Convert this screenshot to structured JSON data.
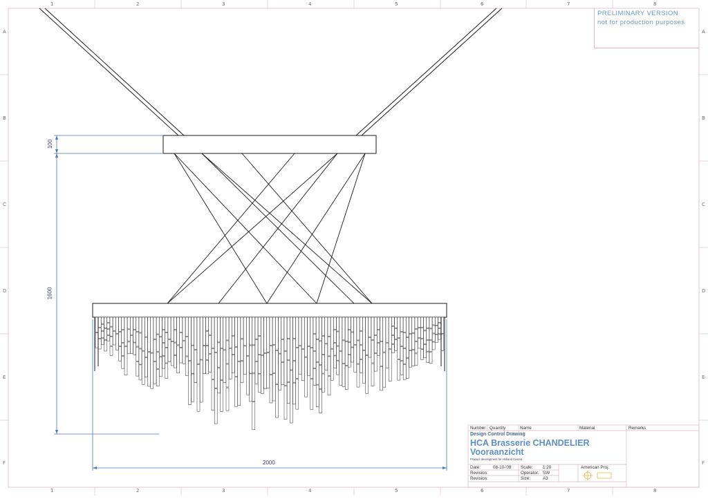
{
  "border": {
    "col_numbers": [
      "1",
      "2",
      "3",
      "4",
      "5",
      "6",
      "7",
      "8"
    ],
    "row_letters": [
      "A",
      "B",
      "C",
      "D",
      "E",
      "F"
    ]
  },
  "preliminary": {
    "line1": "PRELIMINARY  VERSION",
    "line2": "not  for  production  purposes"
  },
  "dimensions": {
    "top_plate": "100",
    "height": "1600",
    "width": "2000"
  },
  "title_block": {
    "headers": {
      "number": "Number",
      "quantity": "Quantity",
      "name": "Name",
      "material": "Material",
      "remarks": "Remarks"
    },
    "drawing_type": "Design Control Drawing",
    "title": "HCA Brasserie CHANDELIER",
    "subtitle": "Vooraanzicht",
    "tagline": "Product development for Holland Casino",
    "date_label": "Date:",
    "date_value": "08-10-'09",
    "scale_label": "Scale:",
    "scale_value": "1:20",
    "revision_label_1": "Revision:",
    "revision_label_2": "Revision:",
    "operator_label": "Operator:",
    "operator_value": "SW",
    "size_label": "Size:",
    "size_value": "A3",
    "projection": "American  Proj."
  },
  "colors": {
    "line": "#1a1a1a",
    "dimension": "#4a78c0",
    "frame": "#d9b8c2",
    "title_blue": "#5b8fc7"
  }
}
